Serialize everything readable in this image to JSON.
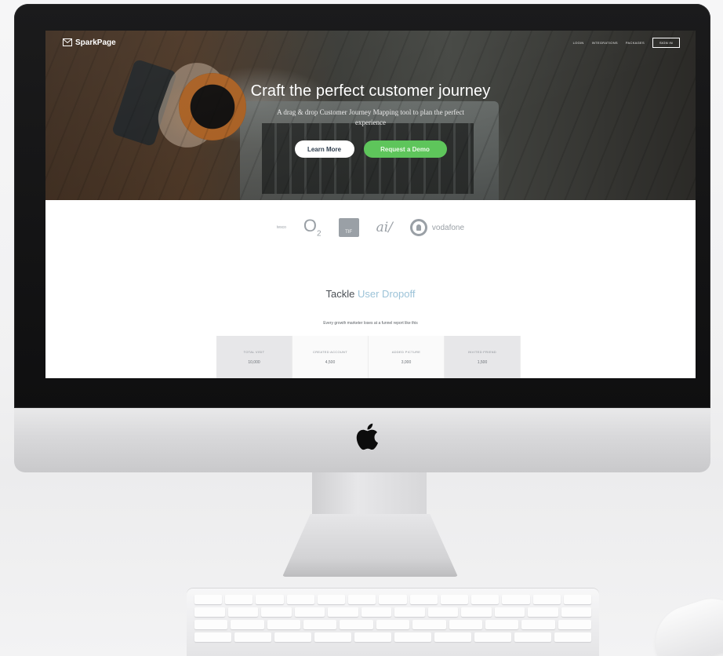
{
  "site": {
    "brand": "SparkPage",
    "nav": {
      "links": [
        "LOGIN",
        "INTEGRATIONS",
        "PACKAGES"
      ],
      "signin": "SIGN IN"
    },
    "hero": {
      "title": "Craft the perfect customer journey",
      "subtitle": "A drag & drop Customer Journey Mapping tool to plan the perfect experience",
      "learn_more": "Learn More",
      "request_demo": "Request a Demo"
    },
    "logos": {
      "first_text": "tesco",
      "o2": "O",
      "o2_sub": "2",
      "box_text": "TIF",
      "script_text": "ai/",
      "vodafone": "vodafone"
    },
    "section": {
      "title_plain": "Tackle ",
      "title_accent": "User Dropoff",
      "subtitle": "Every growth marketer loses at a funnel report like this",
      "stats": [
        {
          "label": "TOTAL VISIT",
          "value": "10,000"
        },
        {
          "label": "CREATED ACCOUNT",
          "value": "4,500"
        },
        {
          "label": "ADDED PICTURE",
          "value": "3,000"
        },
        {
          "label": "INVITED FRIEND",
          "value": "1,500"
        }
      ]
    }
  },
  "colors": {
    "accent_green": "#5ec55b",
    "accent_blue": "#9cc3d8",
    "logo_grey": "#9aa0a6"
  },
  "icons": {
    "brand": "envelope-icon",
    "device": "apple-logo-icon"
  }
}
